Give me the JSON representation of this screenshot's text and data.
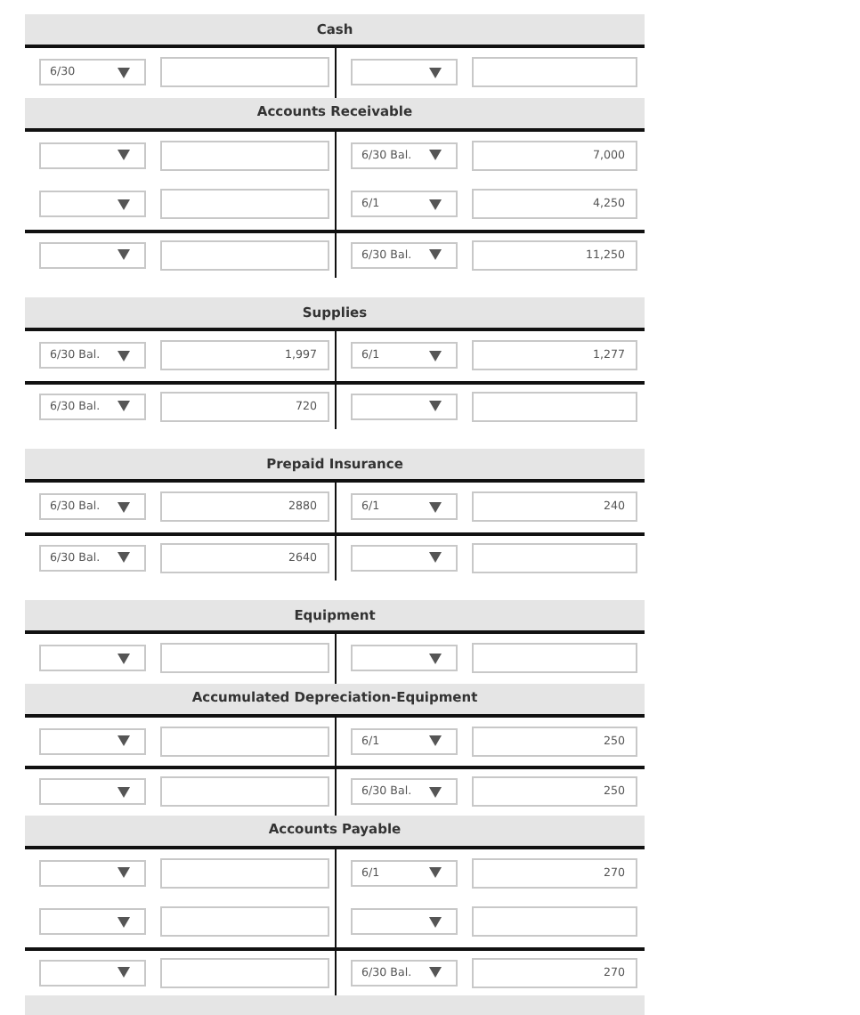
{
  "accounts": [
    {
      "title": "Cash",
      "rows": [
        {
          "debit_date": "6/30",
          "total": false
        }
      ]
    },
    {
      "title": "Accounts Receivable",
      "rows": [
        {
          "credit_date": "6/30 Bal.",
          "credit_amount": "7,000",
          "total": false
        },
        {
          "credit_date": "6/1",
          "credit_amount": "4,250",
          "total": false
        },
        {
          "credit_date": "6/30 Bal.",
          "credit_amount": "11,250",
          "total": true
        }
      ]
    },
    {
      "title": "Supplies",
      "rows": [
        {
          "debit_date": "6/30 Bal.",
          "debit_amount": "1,997",
          "credit_date": "6/1",
          "credit_amount": "1,277",
          "total": false
        },
        {
          "debit_date": "6/30 Bal.",
          "debit_amount": "720",
          "total": true
        }
      ]
    },
    {
      "title": "Prepaid Insurance",
      "rows": [
        {
          "debit_date": "6/30 Bal.",
          "debit_amount": "2880",
          "credit_date": "6/1",
          "credit_amount": "240",
          "total": false
        },
        {
          "debit_date": "6/30 Bal.",
          "debit_amount": "2640",
          "total": true
        }
      ]
    },
    {
      "title": "Equipment",
      "rows": [
        {
          "total": false
        }
      ]
    },
    {
      "title": "Accumulated Depreciation-Equipment",
      "rows": [
        {
          "credit_date": "6/1",
          "credit_amount": "250",
          "total": false
        },
        {
          "credit_date": "6/30 Bal.",
          "credit_amount": "250",
          "total": true
        }
      ]
    },
    {
      "title": "Accounts Payable",
      "rows": [
        {
          "credit_date": "6/1",
          "credit_amount": "270",
          "total": false
        },
        {
          "total": false
        },
        {
          "credit_date": "6/30 Bal.",
          "credit_amount": "270",
          "total": true
        }
      ]
    }
  ]
}
